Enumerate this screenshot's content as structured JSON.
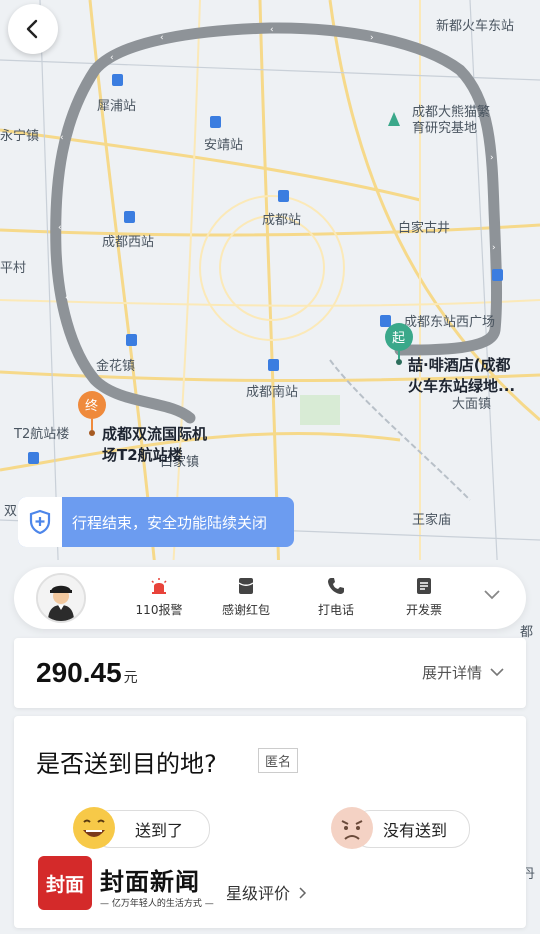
{
  "map": {
    "labels": [
      "新都火车东站",
      "犀浦站",
      "成都大熊猫繁",
      "育研究基地",
      "永宁镇",
      "安靖站",
      "成都站",
      "白家古井",
      "成都西站",
      "平村",
      "成都东站西广场",
      "金花镇",
      "成都南站",
      "大面镇",
      "T2航站楼",
      "白家镇",
      "双",
      "王家庙",
      "都",
      "丹"
    ],
    "start_marker": "起",
    "end_marker": "终",
    "start_poi_line1": "喆·啡酒店(成都",
    "start_poi_line2": "火车东站绿地...",
    "end_poi_line1": "成都双流国际机",
    "end_poi_line2": "场T2航站楼"
  },
  "banner": {
    "text": "行程结束，安全功能陆续关闭"
  },
  "toolbar": {
    "items": [
      {
        "label": "110报警",
        "icon": "alarm-icon",
        "color": "#e8433a"
      },
      {
        "label": "感谢红包",
        "icon": "red-envelope-icon",
        "color": "#444444"
      },
      {
        "label": "打电话",
        "icon": "phone-icon",
        "color": "#444444"
      },
      {
        "label": "开发票",
        "icon": "invoice-icon",
        "color": "#444444"
      }
    ]
  },
  "price": {
    "amount": "290.45",
    "unit": "元",
    "details": "展开详情"
  },
  "question": {
    "title": "是否送到目的地?",
    "anonymous": "匿名",
    "yes": "送到了",
    "no": "没有送到",
    "rating": "星级评价"
  },
  "watermark": {
    "name": "封面新闻",
    "badge": "封面",
    "slogan": "— 亿万年轻人的生活方式 —"
  },
  "colors": {
    "route": "#8e9398",
    "start": "#3aa88a",
    "end": "#ef8a3c",
    "banner": "#6c9cf0",
    "logo": "#d42a2a"
  }
}
